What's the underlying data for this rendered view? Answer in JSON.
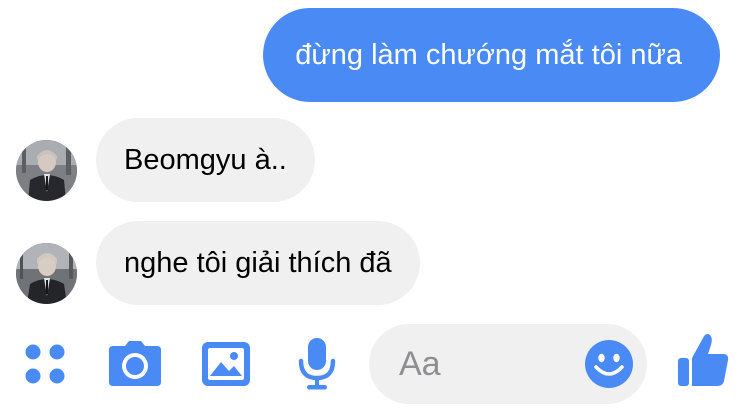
{
  "messages": {
    "outgoing": [
      {
        "text": "đừng làm chướng mắt tôi nữa"
      }
    ],
    "incoming": [
      {
        "text": "Beomgyu à.."
      },
      {
        "text": "nghe tôi giải thích đã"
      }
    ]
  },
  "composer": {
    "placeholder": "Aa",
    "icons": [
      "apps-icon",
      "camera-icon",
      "photo-icon",
      "microphone-icon",
      "emoji-icon",
      "thumbs-up-icon"
    ]
  },
  "colors": {
    "accent": "#4a8af4",
    "incoming_bubble": "#f0f0f1",
    "placeholder": "#8e8e93"
  }
}
